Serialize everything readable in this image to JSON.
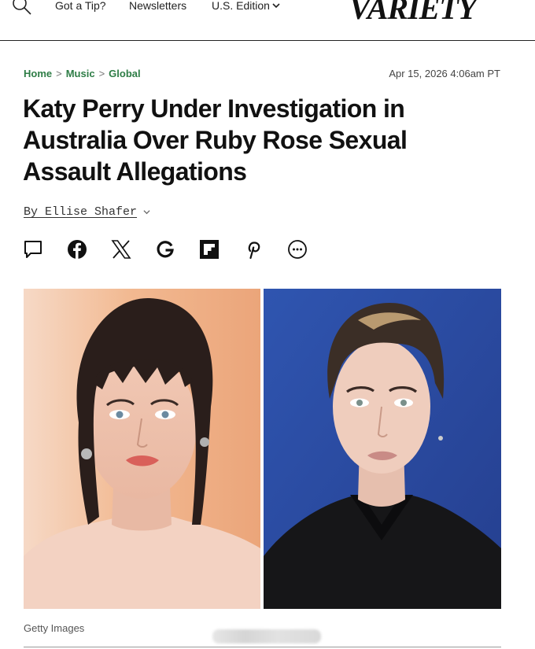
{
  "nav": {
    "tip": "Got a Tip?",
    "newsletters": "Newsletters",
    "edition": "U.S. Edition",
    "logo": "VARIETY"
  },
  "breadcrumb": [
    "Home",
    "Music",
    "Global"
  ],
  "breadcrumb_separator": ">",
  "dateline": "Apr 15, 2026 4:06am PT",
  "headline": "Katy Perry Under Investigation in Australia Over Ruby Rose Sexual Assault Allegations",
  "byline": "By Ellise Shafer",
  "share_icons": [
    "comment-icon",
    "facebook-icon",
    "x-icon",
    "google-icon",
    "flipboard-icon",
    "pinterest-icon",
    "more-icon"
  ],
  "image": {
    "credit": "Getty Images"
  },
  "colors": {
    "link_green": "#2e7d46",
    "text": "#111111",
    "left_photo_bg": "#f0b48e",
    "right_photo_bg": "#2b4aa0"
  }
}
